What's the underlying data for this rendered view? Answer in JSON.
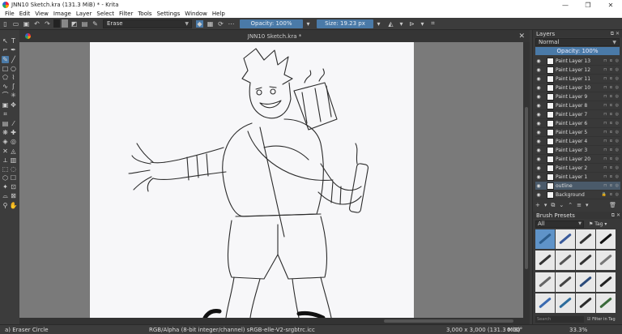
{
  "window": {
    "title": "JNN10 Sketch.kra (131.3 MiB)  * - Krita",
    "controls": [
      "—",
      "❐",
      "✕"
    ]
  },
  "menu": [
    "File",
    "Edit",
    "View",
    "Image",
    "Layer",
    "Select",
    "Filter",
    "Tools",
    "Settings",
    "Window",
    "Help"
  ],
  "toolbar": {
    "brush_preset": "Erase",
    "opacity_label": "Opacity: 100%",
    "size_label": "Size: 19.23 px"
  },
  "document": {
    "tab_title": "JNN10 Sketch.kra *"
  },
  "layers_panel": {
    "title": "Layers",
    "blend_mode": "Normal",
    "opacity": "Opacity:  100%",
    "layers": [
      {
        "name": "Paint Layer 13"
      },
      {
        "name": "Paint Layer 12"
      },
      {
        "name": "Paint Layer 11"
      },
      {
        "name": "Paint Layer 10"
      },
      {
        "name": "Paint Layer 9"
      },
      {
        "name": "Paint Layer 8"
      },
      {
        "name": "Paint Layer 7"
      },
      {
        "name": "Paint Layer 6"
      },
      {
        "name": "Paint Layer 5"
      },
      {
        "name": "Paint Layer 4"
      },
      {
        "name": "Paint Layer 3"
      },
      {
        "name": "Paint Layer 20"
      },
      {
        "name": "Paint Layer 2"
      },
      {
        "name": "Paint Layer 1"
      },
      {
        "name": "outline"
      },
      {
        "name": "Background"
      }
    ]
  },
  "brush_presets": {
    "title": "Brush Presets",
    "filter": "All",
    "tag_label": "Tag",
    "search_placeholder": "Search",
    "filter_in_tag": "Filter in Tag"
  },
  "status": {
    "tool": "a) Eraser Circle",
    "color_info": "RGB/Alpha (8-bit integer/channel)  sRGB-elle-V2-srgbtrc.icc",
    "image_size": "3,000 x 3,000 (131.3 MiB)",
    "rotation": "0.00°",
    "zoom": "33.3%"
  },
  "colors": {
    "accent": "#4a7aa8",
    "panel": "#393939",
    "canvas_bg": "#7a7a7a"
  }
}
